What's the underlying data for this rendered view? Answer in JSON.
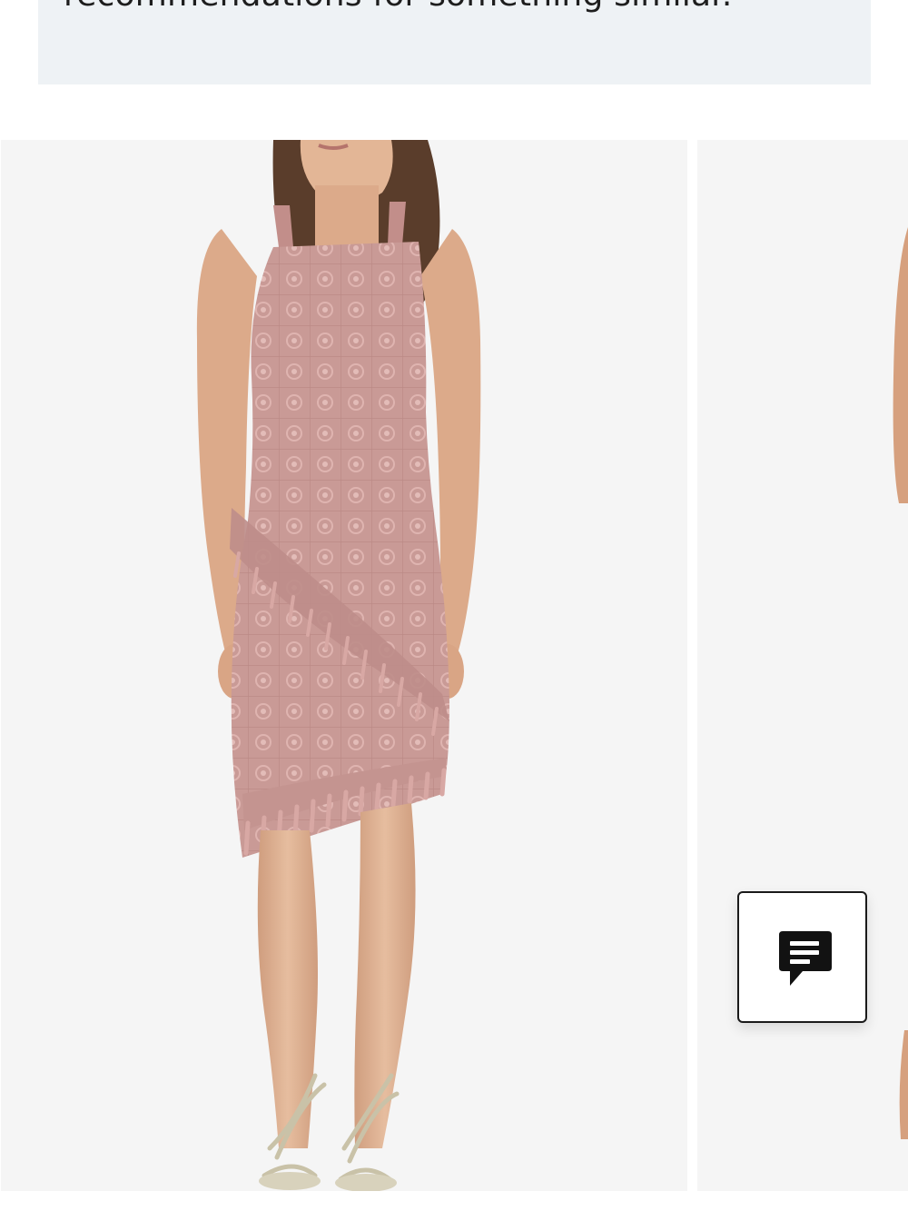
{
  "notice": {
    "text": "recommendations for something similar."
  },
  "carousel": {
    "items": [
      {
        "image_alt": "Woman wearing a blush pink lace sheath dress with an asymmetric tassel-trimmed hem and silver strappy sandals"
      },
      {
        "image_alt": ""
      }
    ]
  },
  "chat": {
    "label": "",
    "icon": "chat-bubble-icon"
  },
  "colors": {
    "banner": "#eef2f5",
    "card_background": "#f5f5f5",
    "dress": "#c99a96",
    "skin": "#e2b494",
    "chat_icon": "#121212"
  }
}
